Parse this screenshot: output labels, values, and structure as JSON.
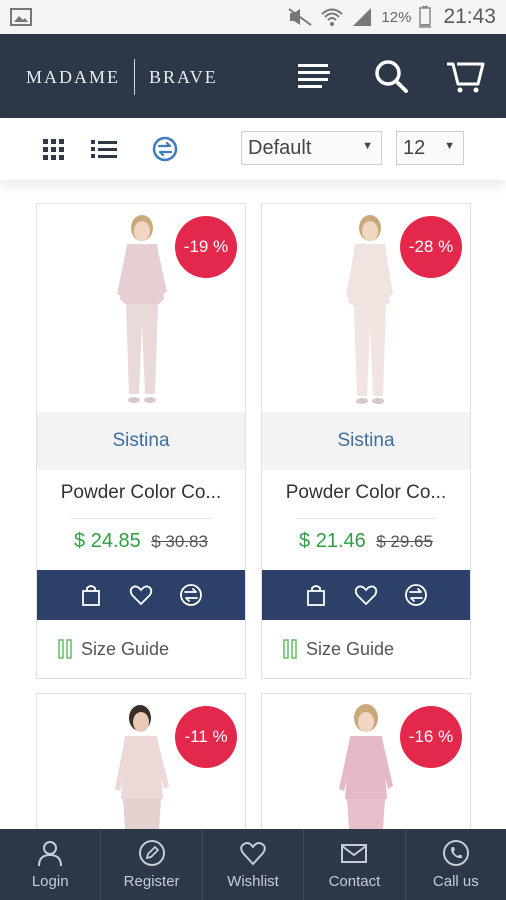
{
  "status_bar": {
    "battery_percent": "12%",
    "time": "21:43",
    "icons": [
      "image-icon",
      "mute-icon",
      "wifi-icon",
      "signal-icon",
      "battery-icon"
    ]
  },
  "header": {
    "logo_left": "MADAME",
    "logo_right": "BRAVE",
    "icons": [
      "menu-icon",
      "search-icon",
      "cart-icon"
    ],
    "background": "#2c3748"
  },
  "toolbar": {
    "view_icons": [
      "grid-view-icon",
      "list-view-icon",
      "compare-icon"
    ],
    "sort_selected": "Default",
    "per_page_selected": "12"
  },
  "products": [
    {
      "discount": "-19 %",
      "brand": "Sistina",
      "name": "Powder Color Co...",
      "price_new": "$ 24.85",
      "price_old": "$ 30.83",
      "size_guide": "Size Guide"
    },
    {
      "discount": "-28 %",
      "brand": "Sistina",
      "name": "Powder Color Co...",
      "price_new": "$ 21.46",
      "price_old": "$ 29.65",
      "size_guide": "Size Guide"
    },
    {
      "discount": "-11 %"
    },
    {
      "discount": "-16 %"
    }
  ],
  "bottom_nav": [
    {
      "label": "Login",
      "icon": "user-icon"
    },
    {
      "label": "Register",
      "icon": "edit-icon"
    },
    {
      "label": "Wishlist",
      "icon": "heart-icon"
    },
    {
      "label": "Contact",
      "icon": "envelope-icon"
    },
    {
      "label": "Call us",
      "icon": "phone-icon"
    }
  ],
  "colors": {
    "accent_navy": "#2c3748",
    "action_bar": "#2d4068",
    "badge_red": "#e3284c",
    "price_green": "#2ea043",
    "brand_blue": "#3e6f9e"
  }
}
